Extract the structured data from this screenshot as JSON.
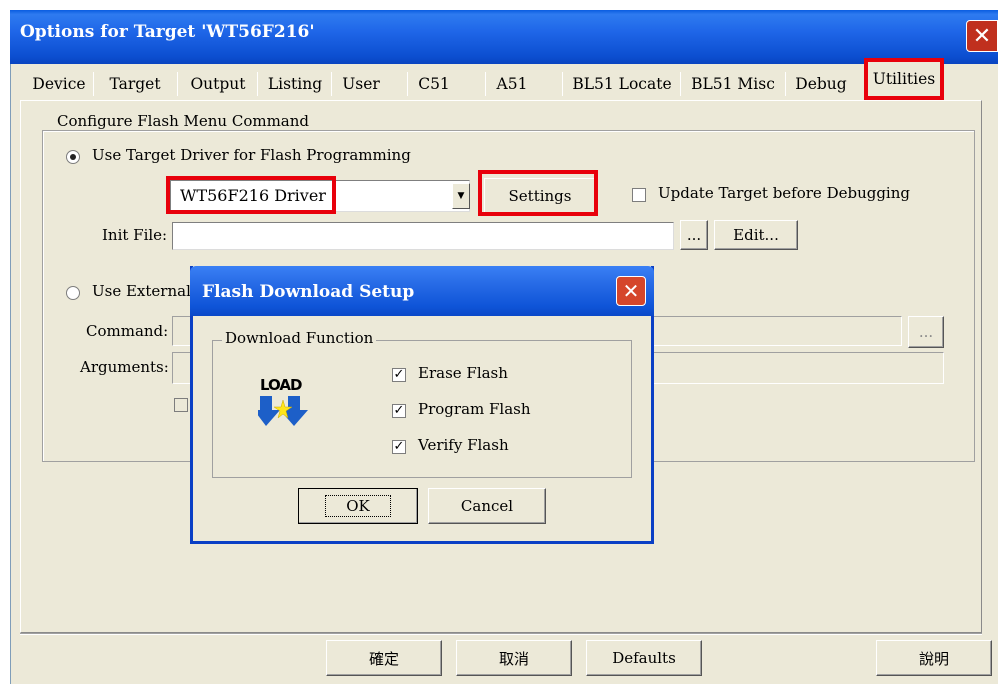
{
  "window": {
    "title": "Options for Target 'WT56F216'",
    "close_label": "✕"
  },
  "tabs": [
    {
      "label": "Device"
    },
    {
      "label": "Target"
    },
    {
      "label": "Output"
    },
    {
      "label": "Listing"
    },
    {
      "label": "User"
    },
    {
      "label": "C51"
    },
    {
      "label": "A51"
    },
    {
      "label": "BL51 Locate"
    },
    {
      "label": "BL51 Misc"
    },
    {
      "label": "Debug"
    },
    {
      "label": "Utilities"
    }
  ],
  "flash_group": {
    "label": "Configure Flash Menu Command",
    "use_target_driver": "Use Target Driver for Flash Programming",
    "driver_value": "WT56F216 Driver",
    "settings_button": "Settings",
    "update_target": "Update Target before Debugging",
    "init_file_label": "Init File:",
    "init_file_value": "",
    "browse_button": "...",
    "edit_button": "Edit...",
    "use_external": "Use External",
    "command_label": "Command:",
    "arguments_label": "Arguments:",
    "command_browse": "..."
  },
  "dialog": {
    "title": "Flash Download Setup",
    "close_label": "✕",
    "group_label": "Download Function",
    "icon_text": "LOAD",
    "options": [
      {
        "label": "Erase Flash",
        "checked": true
      },
      {
        "label": "Program Flash",
        "checked": true
      },
      {
        "label": "Verify Flash",
        "checked": true
      }
    ],
    "ok_button": "OK",
    "cancel_button": "Cancel"
  },
  "footer": {
    "ok_button": "確定",
    "cancel_button": "取消",
    "defaults_button": "Defaults",
    "help_button": "說明"
  },
  "highlight_color": "#e8000b"
}
